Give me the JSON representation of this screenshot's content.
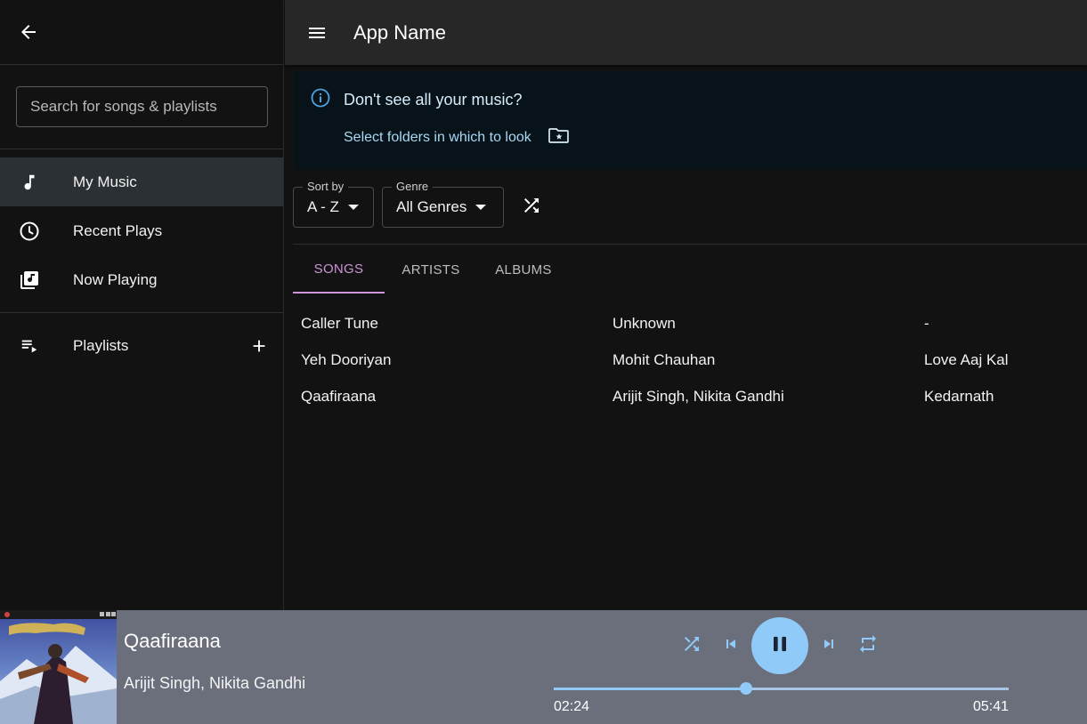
{
  "app": {
    "title": "App Name"
  },
  "search": {
    "placeholder": "Search for songs & playlists"
  },
  "nav": {
    "items": [
      {
        "label": "My Music",
        "icon": "music-note-icon",
        "active": true
      },
      {
        "label": "Recent Plays",
        "icon": "clock-icon",
        "active": false
      },
      {
        "label": "Now Playing",
        "icon": "queue-music-icon",
        "active": false
      }
    ],
    "playlists_label": "Playlists"
  },
  "banner": {
    "message": "Don't see all your music?",
    "link": "Select folders in which to look"
  },
  "filters": {
    "sort_label": "Sort by",
    "sort_value": "A - Z",
    "genre_label": "Genre",
    "genre_value": "All Genres"
  },
  "tabs": [
    {
      "label": "SONGS",
      "active": true
    },
    {
      "label": "ARTISTS",
      "active": false
    },
    {
      "label": "ALBUMS",
      "active": false
    }
  ],
  "songs": [
    {
      "title": "Caller Tune",
      "artist": "Unknown",
      "album": "-"
    },
    {
      "title": "Yeh Dooriyan",
      "artist": "Mohit Chauhan",
      "album": "Love Aaj Kal"
    },
    {
      "title": "Qaafiraana",
      "artist": "Arijit Singh, Nikita Gandhi",
      "album": "Kedarnath"
    }
  ],
  "now_playing": {
    "title": "Qaafiraana",
    "artist": "Arijit Singh, Nikita Gandhi",
    "elapsed": "02:24",
    "total": "05:41",
    "progress_fraction": 0.422
  },
  "colors": {
    "accent_tab": "#ce93d8",
    "accent_player": "#90caf9",
    "player_bg": "#6b6f7c",
    "banner_bg": "#071318"
  }
}
